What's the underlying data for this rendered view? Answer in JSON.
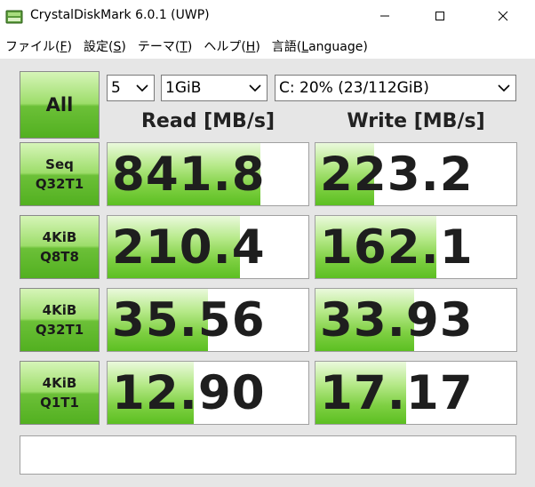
{
  "window": {
    "title": "CrystalDiskMark 6.0.1 (UWP)",
    "icons": {
      "app": "disk-icon",
      "minimize": "minimize-icon",
      "maximize": "maximize-icon",
      "close": "close-icon"
    }
  },
  "menu": [
    {
      "label": "ファイル(",
      "accel": "F",
      "suffix": ")"
    },
    {
      "label": "設定(",
      "accel": "S",
      "suffix": ")"
    },
    {
      "label": "テーマ(",
      "accel": "T",
      "suffix": ")"
    },
    {
      "label": "ヘルプ(",
      "accel": "H",
      "suffix": ")"
    },
    {
      "label": "言語(",
      "accel": "L",
      "suffix": "anguage)"
    }
  ],
  "controls": {
    "all_label": "All",
    "count": "5",
    "size": "1GiB",
    "drive": "C: 20% (23/112GiB)"
  },
  "headers": {
    "read": "Read [MB/s]",
    "write": "Write [MB/s]"
  },
  "tests": [
    {
      "line1": "Seq",
      "line2": "Q32T1",
      "read": "841.8",
      "write": "223.2",
      "read_fill": 0.76,
      "write_fill": 0.29
    },
    {
      "line1": "4KiB",
      "line2": "Q8T8",
      "read": "210.4",
      "write": "162.1",
      "read_fill": 0.66,
      "write_fill": 0.6
    },
    {
      "line1": "4KiB",
      "line2": "Q32T1",
      "read": "35.56",
      "write": "33.93",
      "read_fill": 0.5,
      "write_fill": 0.49
    },
    {
      "line1": "4KiB",
      "line2": "Q1T1",
      "read": "12.90",
      "write": "17.17",
      "read_fill": 0.43,
      "write_fill": 0.45
    }
  ],
  "colors": {
    "green_dark": "#52b020",
    "green_light": "#d6f5b8",
    "panel_bg": "#e6e6e6"
  },
  "comment": ""
}
